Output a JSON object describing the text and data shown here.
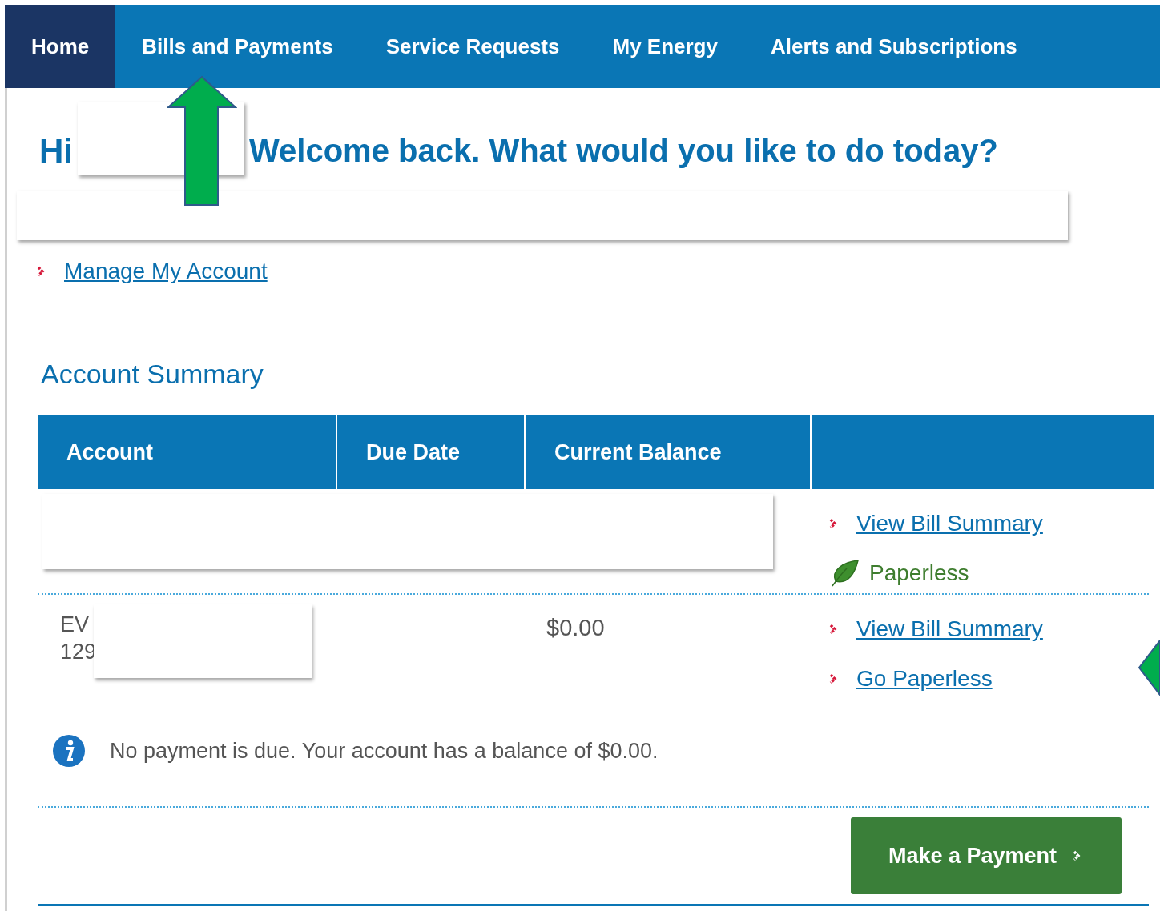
{
  "nav": {
    "tabs": [
      {
        "label": "Home",
        "selected": true
      },
      {
        "label": "Bills and Payments",
        "selected": false
      },
      {
        "label": "Service Requests",
        "selected": false
      },
      {
        "label": "My Energy",
        "selected": false
      },
      {
        "label": "Alerts and Subscriptions",
        "selected": false
      }
    ]
  },
  "greeting": {
    "prefix": "Hi",
    "text": "Welcome back. What would you like to do today?"
  },
  "manage_link": "Manage My Account",
  "account_summary": {
    "title": "Account Summary",
    "columns": [
      "Account",
      "Due Date",
      "Current Balance"
    ],
    "rows": [
      {
        "kind": "redacted",
        "actions": [
          {
            "kind": "link",
            "label": "View Bill Summary"
          },
          {
            "kind": "status",
            "label": "Paperless"
          }
        ]
      },
      {
        "kind": "account",
        "account_lines": [
          "EV",
          "129"
        ],
        "balance": "$0.00",
        "actions": [
          {
            "kind": "link",
            "label": "View Bill Summary"
          },
          {
            "kind": "link",
            "label": "Go Paperless"
          }
        ]
      }
    ]
  },
  "info_message": "No payment is due. Your account has a balance of $0.00.",
  "payment_button": "Make a Payment"
}
